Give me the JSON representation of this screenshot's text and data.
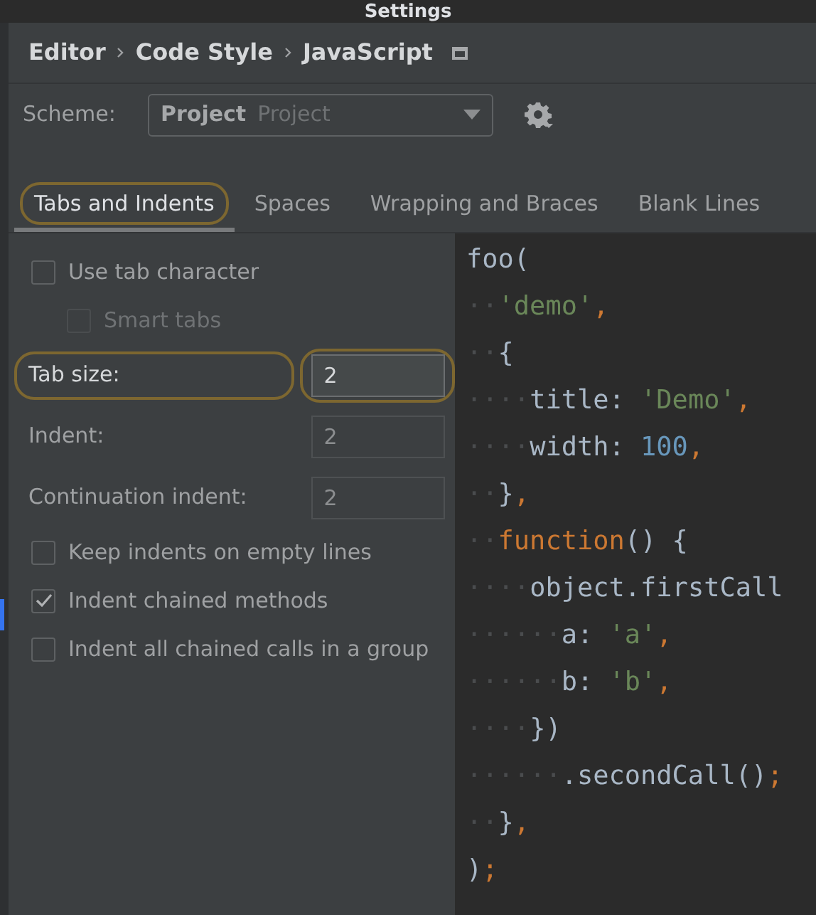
{
  "window": {
    "title": "Settings"
  },
  "breadcrumb": [
    "Editor",
    "Code Style",
    "JavaScript"
  ],
  "scheme": {
    "label": "Scheme:",
    "value": "Project",
    "hint": "Project"
  },
  "tabs": [
    {
      "label": "Tabs and Indents",
      "selected": true,
      "highlighted": true
    },
    {
      "label": "Spaces",
      "selected": false,
      "highlighted": false
    },
    {
      "label": "Wrapping and Braces",
      "selected": false,
      "highlighted": false
    },
    {
      "label": "Blank Lines",
      "selected": false,
      "highlighted": false
    }
  ],
  "options": [
    {
      "kind": "checkbox",
      "label": "Use tab character",
      "checked": false,
      "disabled": false,
      "children": [
        {
          "kind": "checkbox",
          "label": "Smart tabs",
          "checked": false,
          "disabled": true
        }
      ]
    },
    {
      "kind": "number",
      "label": "Tab size:",
      "value": "2",
      "highlighted": true
    },
    {
      "kind": "number",
      "label": "Indent:",
      "value": "2",
      "highlighted": false
    },
    {
      "kind": "number",
      "label": "Continuation indent:",
      "value": "2",
      "highlighted": false
    },
    {
      "kind": "checkbox",
      "label": "Keep indents on empty lines",
      "checked": false,
      "disabled": false
    },
    {
      "kind": "checkbox",
      "label": "Indent chained methods",
      "checked": true,
      "disabled": false
    },
    {
      "kind": "checkbox",
      "label": "Indent all chained calls in a group",
      "checked": false,
      "disabled": false
    }
  ],
  "code_lines": [
    [
      {
        "kind": "plain",
        "text": "foo("
      }
    ],
    [
      {
        "kind": "ws",
        "text": "··"
      },
      {
        "kind": "string",
        "text": "'demo'"
      },
      {
        "kind": "punct",
        "text": ","
      }
    ],
    [
      {
        "kind": "ws",
        "text": "··"
      },
      {
        "kind": "plain",
        "text": "{"
      }
    ],
    [
      {
        "kind": "ws",
        "text": "····"
      },
      {
        "kind": "plain",
        "text": "title: "
      },
      {
        "kind": "string",
        "text": "'Demo'"
      },
      {
        "kind": "punct",
        "text": ","
      }
    ],
    [
      {
        "kind": "ws",
        "text": "····"
      },
      {
        "kind": "plain",
        "text": "width: "
      },
      {
        "kind": "number",
        "text": "100"
      },
      {
        "kind": "punct",
        "text": ","
      }
    ],
    [
      {
        "kind": "ws",
        "text": "··"
      },
      {
        "kind": "plain",
        "text": "}"
      },
      {
        "kind": "punct",
        "text": ","
      }
    ],
    [
      {
        "kind": "ws",
        "text": "··"
      },
      {
        "kind": "keyword",
        "text": "function"
      },
      {
        "kind": "plain",
        "text": "() {"
      }
    ],
    [
      {
        "kind": "ws",
        "text": "····"
      },
      {
        "kind": "plain",
        "text": "object.firstCall"
      }
    ],
    [
      {
        "kind": "ws",
        "text": "······"
      },
      {
        "kind": "plain",
        "text": "a: "
      },
      {
        "kind": "string",
        "text": "'a'"
      },
      {
        "kind": "punct",
        "text": ","
      }
    ],
    [
      {
        "kind": "ws",
        "text": "······"
      },
      {
        "kind": "plain",
        "text": "b: "
      },
      {
        "kind": "string",
        "text": "'b'"
      },
      {
        "kind": "punct",
        "text": ","
      }
    ],
    [
      {
        "kind": "ws",
        "text": "····"
      },
      {
        "kind": "plain",
        "text": "})"
      }
    ],
    [
      {
        "kind": "ws",
        "text": "······"
      },
      {
        "kind": "plain",
        "text": ".secondCall()"
      },
      {
        "kind": "punct",
        "text": ";"
      }
    ],
    [
      {
        "kind": "ws",
        "text": "··"
      },
      {
        "kind": "plain",
        "text": "}"
      },
      {
        "kind": "punct",
        "text": ","
      }
    ],
    [
      {
        "kind": "plain",
        "text": ")"
      },
      {
        "kind": "punct",
        "text": ";"
      }
    ]
  ]
}
